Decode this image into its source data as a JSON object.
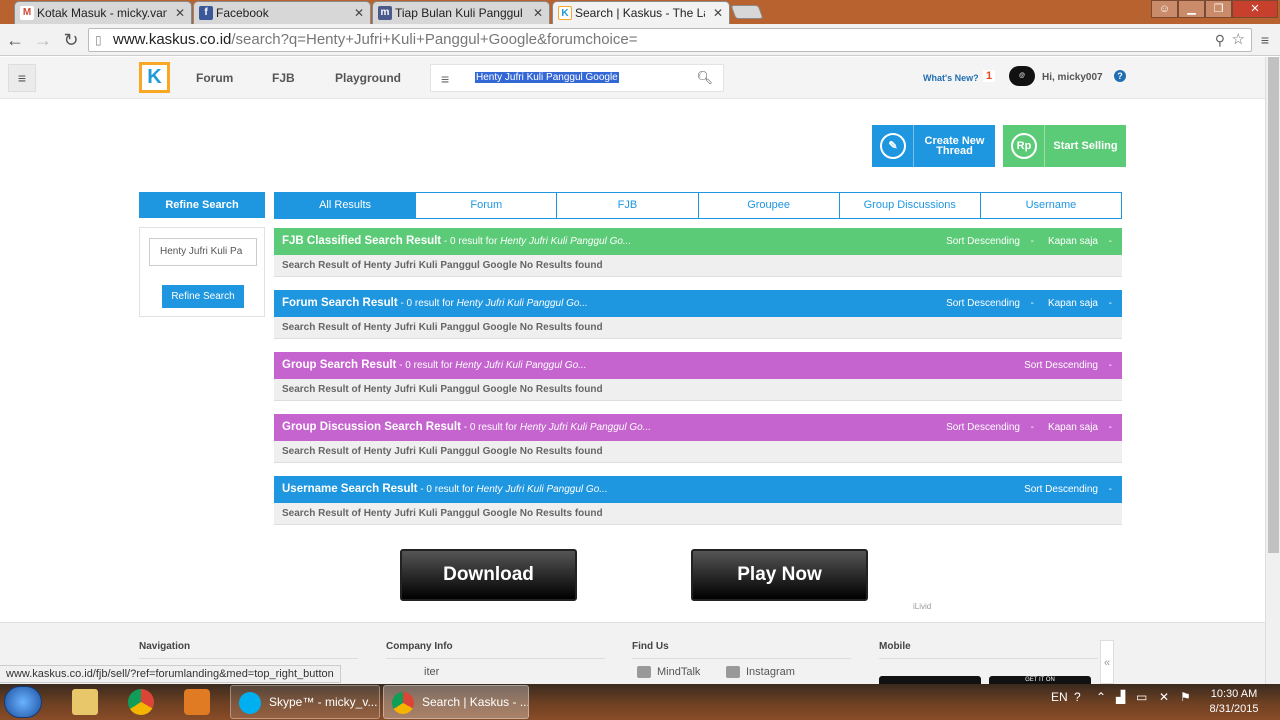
{
  "browser": {
    "tabs": [
      {
        "title": "Kotak Masuk - micky.vanz",
        "icon": "gmail-icon",
        "icon_glyph": "M",
        "color": "#d14836"
      },
      {
        "title": "Facebook",
        "icon": "facebook-icon",
        "icon_glyph": "f",
        "color": "#3b5998"
      },
      {
        "title": "Tiap Bulan Kuli Panggul L",
        "icon": "page-icon",
        "icon_glyph": "m",
        "color": "#4a5a8a"
      },
      {
        "title": "Search | Kaskus - The Larg",
        "icon": "kaskus-icon",
        "icon_glyph": "K",
        "color": "#1f9bd7",
        "active": true
      }
    ],
    "url_host": "www.kaskus.co.id",
    "url_path": "/search?q=Henty+Jufri+Kuli+Panggul+Google&forumchoice=",
    "status_url": "www.kaskus.co.id/fjb/sell/?ref=forumlanding&med=top_right_button"
  },
  "header": {
    "logo": "K",
    "nav": [
      "Forum",
      "FJB",
      "Playground"
    ],
    "search_value": "Henty Jufri Kuli Panggul Google",
    "whats_new": "What's New?",
    "notif_count": "1",
    "greeting": "Hi, micky007"
  },
  "actions": {
    "create_thread": "Create New Thread",
    "create_icon": "pencil-icon",
    "start_selling": "Start Selling",
    "sell_icon_text": "Rp"
  },
  "refine": {
    "title": "Refine Search",
    "input_value": "Henty Jufri Kuli Pa",
    "button": "Refine Search"
  },
  "tabs": [
    "All Results",
    "Forum",
    "FJB",
    "Groupee",
    "Group Discussions",
    "Username"
  ],
  "results": [
    {
      "title": "FJB Classified Search Result",
      "count": " - 0 result for ",
      "query": "Henty Jufri Kuli Panggul Go...",
      "sort": "Sort Descending",
      "kapan": "Kapan saja",
      "color": "#5ccb78",
      "body": "Search Result of Henty Jufri Kuli Panggul Google No Results found"
    },
    {
      "title": "Forum Search Result",
      "count": " - 0 result for ",
      "query": "Henty Jufri Kuli Panggul Go...",
      "sort": "Sort Descending",
      "kapan": "Kapan saja",
      "color": "#1e96e0",
      "body": "Search Result of Henty Jufri Kuli Panggul Google No Results found"
    },
    {
      "title": "Group Search Result",
      "count": " - 0 result for ",
      "query": "Henty Jufri Kuli Panggul Go...",
      "sort": "Sort Descending",
      "kapan": "",
      "color": "#c563cf",
      "body": "Search Result of Henty Jufri Kuli Panggul Google No Results found"
    },
    {
      "title": "Group Discussion Search Result",
      "count": " - 0 result for ",
      "query": "Henty Jufri Kuli Panggul Go...",
      "sort": "Sort Descending",
      "kapan": "Kapan saja",
      "color": "#c563cf",
      "body": "Search Result of Henty Jufri Kuli Panggul Google No Results found"
    },
    {
      "title": "Username Search Result",
      "count": " - 0 result for ",
      "query": "Henty Jufri Kuli Panggul Go...",
      "sort": "Sort Descending",
      "kapan": "",
      "color": "#1e96e0",
      "body": "Search Result of Henty Jufri Kuli Panggul Google No Results found"
    }
  ],
  "ads": {
    "download": "Download",
    "play": "Play Now",
    "brand": "iLivid"
  },
  "footer": {
    "navigation": "Navigation",
    "company": "Company Info",
    "company_item": "iter",
    "findus": "Find Us",
    "mindtalk": "MindTalk",
    "instagram": "Instagram",
    "mobile": "Mobile",
    "store_badge": "GET IT ON"
  },
  "taskbar": {
    "windows": [
      {
        "title": "Skype™ - micky_v...",
        "color": "#00aff0"
      },
      {
        "title": "Search | Kaskus - ...",
        "color": "#4caf50"
      }
    ],
    "lang": "EN",
    "time": "10:30 AM",
    "date": "8/31/2015"
  }
}
